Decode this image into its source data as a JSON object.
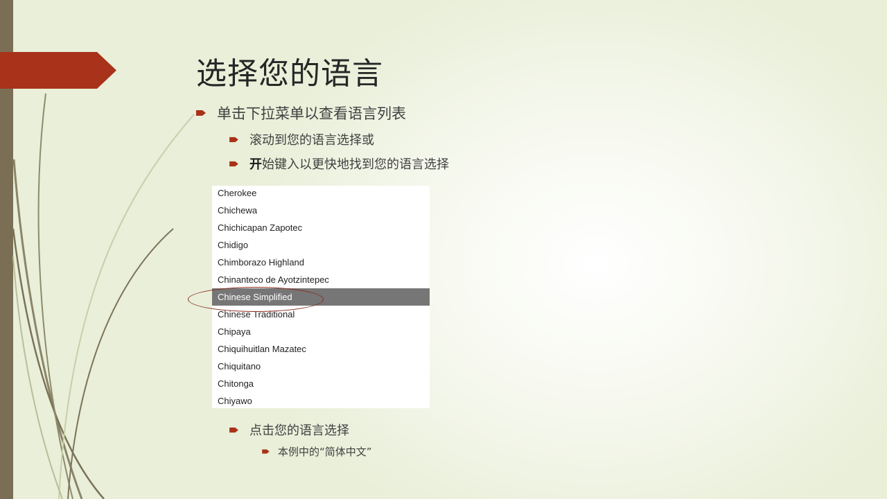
{
  "slide": {
    "title": "选择您的语言",
    "bullets": {
      "level1": "单击下拉菜单以查看语言列表",
      "level2_scroll": "滚动到您的语言选择或",
      "level2_type_bold": "开",
      "level2_type_rest": "始键入以更快地找到您的语言选择",
      "level2_click": "点击您的语言选择",
      "level3_example": "本例中的“简体中文”"
    }
  },
  "language_dropdown": {
    "items": [
      "Cherokee",
      "Chichewa",
      "Chichicapan Zapotec",
      "Chidigo",
      "Chimborazo Highland",
      "Chinanteco de Ayotzintepec",
      "Chinese Simplified",
      "Chinese Traditional",
      "Chipaya",
      "Chiquihuitlan Mazatec",
      "Chiquitano",
      "Chitonga",
      "Chiyawo"
    ],
    "selected": "Chinese Simplified"
  },
  "colors": {
    "accent": "#a8321a",
    "side_bar": "#7a6f55",
    "selection_bg": "#767676",
    "circle": "#8a2a1c"
  },
  "icons": {
    "bullet": "arrow-bullet-icon"
  }
}
